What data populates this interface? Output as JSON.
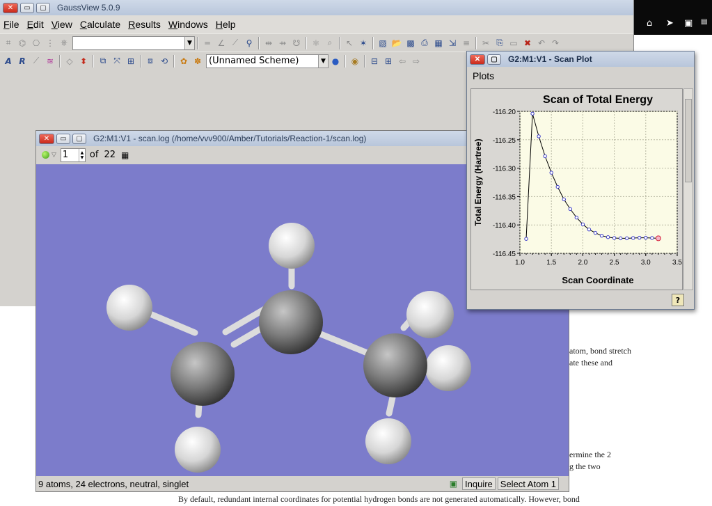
{
  "main_window": {
    "title": "GaussView 5.0.9",
    "menu": [
      {
        "label": "File",
        "mnemonic": "F",
        "rest": "ile"
      },
      {
        "label": "Edit",
        "mnemonic": "E",
        "rest": "dit"
      },
      {
        "label": "View",
        "mnemonic": "V",
        "rest": "iew"
      },
      {
        "label": "Calculate",
        "mnemonic": "C",
        "rest": "alculate"
      },
      {
        "label": "Results",
        "mnemonic": "R",
        "rest": "esults"
      },
      {
        "label": "Windows",
        "mnemonic": "W",
        "rest": "indows"
      },
      {
        "label": "Help",
        "mnemonic": "H",
        "rest": "elp"
      }
    ],
    "scheme_combo_value": "(Unnamed Scheme)"
  },
  "viewer_window": {
    "title": "G2:M1:V1 - scan.log (/home/vvv900/Amber/Tutorials/Reaction-1/scan.log)",
    "frame_current": "1",
    "frame_of_label": "of",
    "frame_total": "22",
    "status_text": "9 atoms, 24 electrons, neutral, singlet",
    "inquire_label": "Inquire",
    "select_atom_label": "Select Atom 1",
    "viewport_background": "#7c7ccb"
  },
  "scan_window": {
    "title": "G2:M1:V1 - Scan Plot",
    "menu_plots": "Plots",
    "help_label": "?"
  },
  "chart_data": {
    "type": "line",
    "title": "Scan of Total Energy",
    "xlabel": "Scan Coordinate",
    "ylabel": "Total Energy (Hartree)",
    "xlim": [
      1.0,
      3.5
    ],
    "ylim": [
      -116.45,
      -116.2
    ],
    "xticks": [
      "1.0",
      "1.5",
      "2.0",
      "2.5",
      "3.0",
      "3.5"
    ],
    "yticks": [
      "-116.20",
      "-116.25",
      "-116.30",
      "-116.35",
      "-116.40",
      "-116.45"
    ],
    "x": [
      1.1,
      1.2,
      1.3,
      1.4,
      1.5,
      1.6,
      1.7,
      1.8,
      1.9,
      2.0,
      2.1,
      2.2,
      2.3,
      2.4,
      2.5,
      2.6,
      2.7,
      2.8,
      2.9,
      3.0,
      3.1,
      3.2
    ],
    "y": [
      -116.4245,
      -116.204,
      -116.244,
      -116.279,
      -116.308,
      -116.333,
      -116.355,
      -116.372,
      -116.387,
      -116.399,
      -116.408,
      -116.414,
      -116.419,
      -116.4215,
      -116.423,
      -116.4235,
      -116.4235,
      -116.423,
      -116.4225,
      -116.4225,
      -116.423,
      -116.4235
    ],
    "grid": true,
    "line_color": "#000000",
    "marker_color": "#3b3bc8",
    "highlight_index": 21,
    "highlight_color": "#d7263d"
  },
  "document_text": {
    "line1": "atom, bond stretch",
    "line2": "ate these and",
    "line3": "ermine the 2",
    "line4": "g the two",
    "line5": "By default, redundant internal coordinates for potential hydrogen bonds are not generated automatically. However, bond"
  },
  "tray": {
    "icons": [
      "home-icon",
      "send-icon",
      "network-icon",
      "folder-icon"
    ]
  }
}
